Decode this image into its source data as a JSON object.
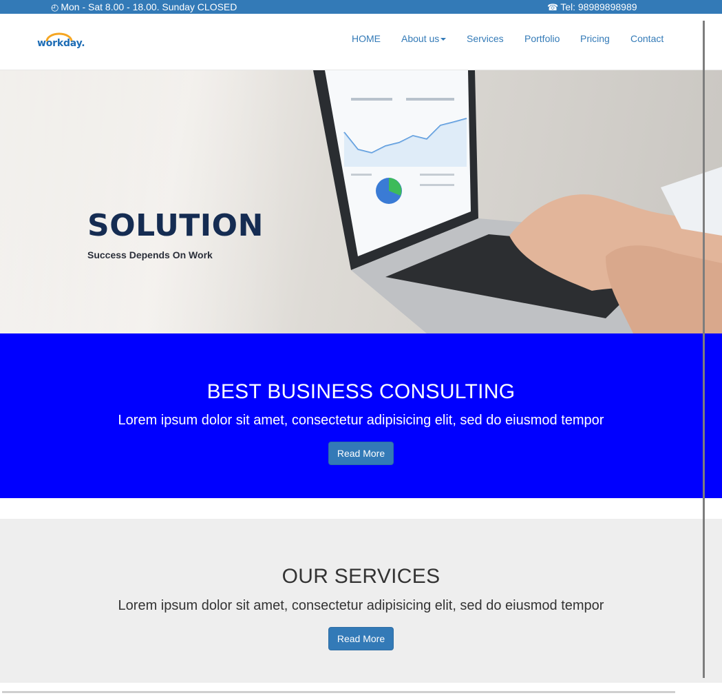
{
  "topbar": {
    "hours_icon": "clock-icon",
    "hours_glyph": "◴",
    "hours_text": "Mon - Sat 8.00 - 18.00. Sunday CLOSED",
    "phone_icon": "phone-icon",
    "phone_glyph": "☎",
    "phone_text": "Tel: 98989898989"
  },
  "brand": {
    "logo_text": "workday.",
    "logo_arc_color": "#f5a623",
    "logo_text_color": "#1e6db5"
  },
  "nav": {
    "items": [
      {
        "label": "HOME"
      },
      {
        "label": "About us",
        "has_dropdown": true
      },
      {
        "label": "Services"
      },
      {
        "label": "Portfolio"
      },
      {
        "label": "Pricing"
      },
      {
        "label": "Contact"
      }
    ],
    "link_color": "#337ab7"
  },
  "hero": {
    "title": "SOLUTION",
    "subtitle": "Success Depends On Work",
    "title_color": "#152c52"
  },
  "consulting": {
    "title": "BEST BUSINESS CONSULTING",
    "text": "Lorem ipsum dolor sit amet, consectetur adipisicing elit, sed do eiusmod tempor",
    "button": "Read More",
    "background": "#0000ff"
  },
  "services": {
    "title": "OUR SERVICES",
    "text": "Lorem ipsum dolor sit amet, consectetur adipisicing elit, sed do eiusmod tempor",
    "button": "Read More",
    "background": "#eeeeee"
  },
  "colors": {
    "primary": "#337ab7"
  }
}
